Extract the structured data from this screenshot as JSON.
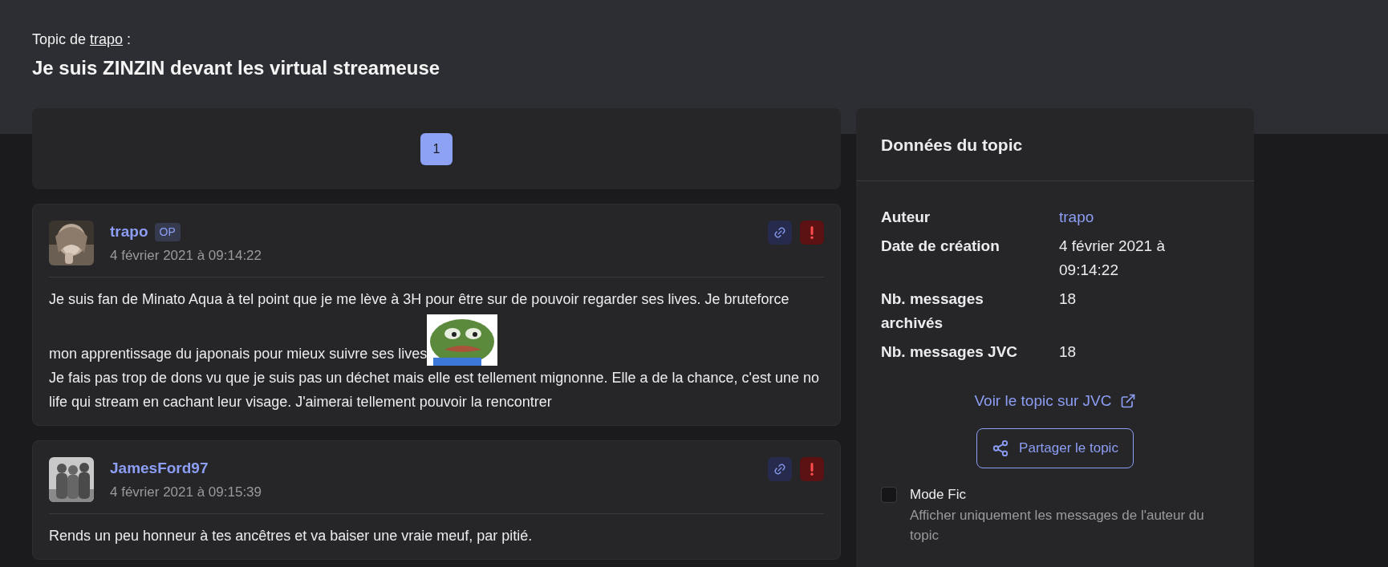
{
  "header": {
    "prefix": "Topic de",
    "author": "trapo",
    "suffix": ":",
    "title": "Je suis ZINZIN devant les virtual streameuse"
  },
  "pagination": [
    {
      "label": "1",
      "selected": true
    }
  ],
  "posts": [
    {
      "author": "trapo",
      "badge": "OP",
      "date": "4 février 2021 à 09:14:22",
      "lines": [
        {
          "text": "Je suis fan de Minato Aqua à tel point que je me lève à 3H pour être sur de pouvoir regarder ses lives. Je bruteforce",
          "sticker": false
        },
        {
          "text": "mon apprentissage du japonais pour mieux suivre ses lives",
          "sticker": true
        },
        {
          "text": "Je fais pas trop de dons vu que je suis pas un déchet mais elle est tellement mignonne. Elle a de la chance, c'est une no life qui stream en cachant leur visage. J'aimerai tellement pouvoir la rencontrer",
          "sticker": false
        }
      ]
    },
    {
      "author": "JamesFord97",
      "date": "4 février 2021 à 09:15:39",
      "lines": [
        {
          "text": "Rends un peu honneur à tes ancêtres et va baiser une vraie meuf, par pitié.",
          "sticker": false
        }
      ]
    }
  ],
  "sidebar": {
    "title": "Données du topic",
    "fields": [
      {
        "label": "Auteur",
        "value": "trapo",
        "kind": "link"
      },
      {
        "label": "Date de création",
        "value": "4 février 2021 à 09:14:22",
        "kind": "text"
      },
      {
        "label": "Nb. messages archivés",
        "value": "18",
        "kind": "text"
      },
      {
        "label": "Nb. messages JVC",
        "value": "18",
        "kind": "text"
      }
    ],
    "external_link": "Voir le topic sur JVC",
    "share_button": "Partager le topic",
    "mode_fic": {
      "label": "Mode Fic",
      "description": "Afficher uniquement les messages de l'auteur du topic",
      "checked": false
    }
  }
}
